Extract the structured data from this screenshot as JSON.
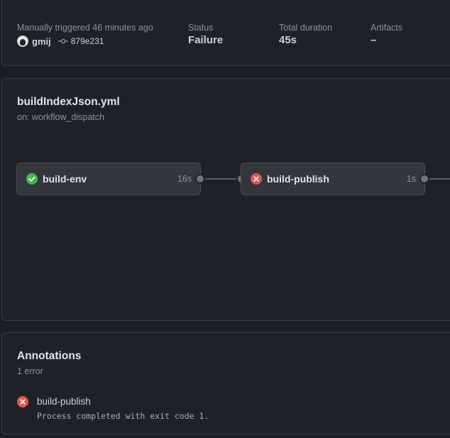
{
  "summary": {
    "trigger_text": "Manually triggered 46 minutes ago",
    "actor": "gmij",
    "commit_sha": "879e231",
    "status_label": "Status",
    "status_value": "Failure",
    "duration_label": "Total duration",
    "duration_value": "45s",
    "artifacts_label": "Artifacts",
    "artifacts_value": "–"
  },
  "workflow": {
    "file_name": "buildIndexJson.yml",
    "trigger": "on: workflow_dispatch",
    "jobs": [
      {
        "name": "build-env",
        "duration": "16s",
        "status": "success",
        "status_color": "#3fb950"
      },
      {
        "name": "build-publish",
        "duration": "1s",
        "status": "failure",
        "status_color": "#e5534b"
      }
    ]
  },
  "annotations": {
    "title": "Annotations",
    "count_text": "1 error",
    "items": [
      {
        "job": "build-publish",
        "message": "Process completed with exit code 1.",
        "level": "error",
        "color": "#e5534b"
      }
    ]
  }
}
